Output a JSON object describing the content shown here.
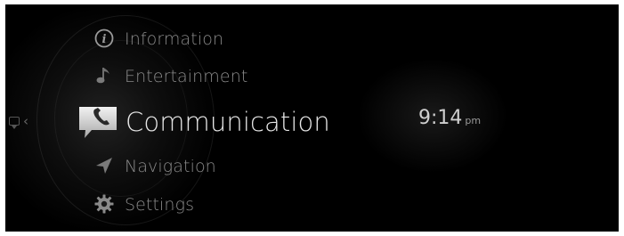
{
  "menu": {
    "items": [
      {
        "label": "Information",
        "icon": "info-icon"
      },
      {
        "label": "Entertainment",
        "icon": "music-note-icon"
      },
      {
        "label": "Communication",
        "icon": "phone-icon",
        "selected": true
      },
      {
        "label": "Navigation",
        "icon": "navigation-arrow-icon"
      },
      {
        "label": "Settings",
        "icon": "gear-icon"
      }
    ]
  },
  "clock": {
    "time": "9:14",
    "ampm": "pm"
  },
  "colors": {
    "background": "#000000",
    "text_inactive": "#8a8a8a",
    "text_active": "#e6e6e6"
  }
}
